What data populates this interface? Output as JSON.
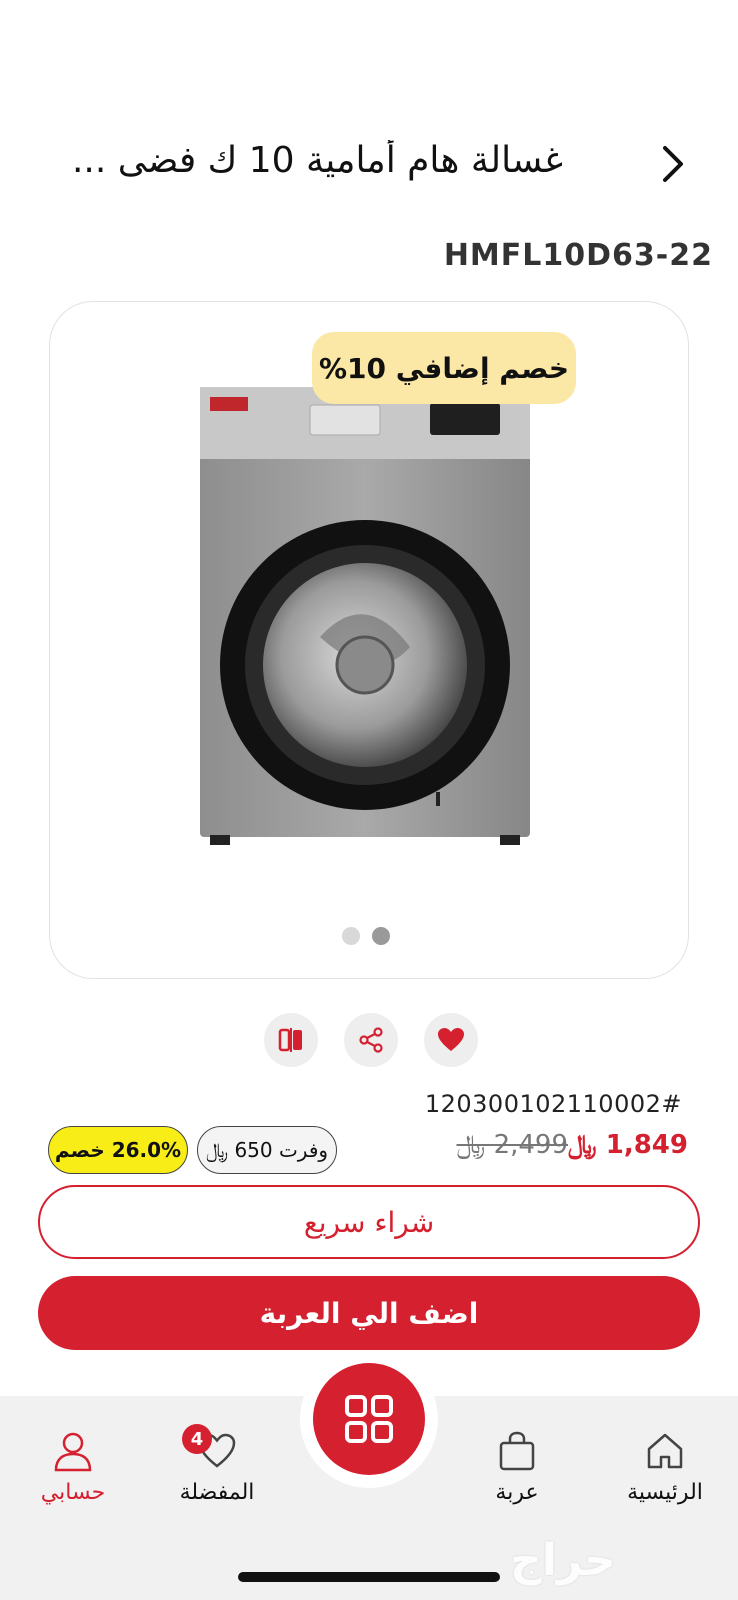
{
  "header": {
    "title": "غسالة هام أمامية 10 ك فضى ..."
  },
  "product": {
    "model_code": "HMFL10D63-22",
    "promo_badge": "خصم إضافي 10%",
    "image_icon": "washing-machine-image",
    "gallery_total": 2,
    "gallery_active": 2,
    "sku": "120300102110002#",
    "price_new": "1,849 ﷼",
    "price_old": "2,499 ﷼",
    "savings": "وفرت 650 ﷼",
    "discount": "26.0% خصم"
  },
  "actions": {
    "compare_icon": "compare-icon",
    "share_icon": "share-icon",
    "favorite_icon": "heart-icon"
  },
  "buttons": {
    "quick_buy": "شراء سريع",
    "add_to_cart": "اضف الي العربة"
  },
  "nav": {
    "account": "حسابي",
    "favorites": "المفضلة",
    "favorites_count": "4",
    "cart": "عربة",
    "home": "الرئيسية"
  },
  "watermark": "حراج",
  "colors": {
    "accent": "#d5202f",
    "promo_bg": "#fbe8a6",
    "discount_bg": "#f9ed17"
  }
}
